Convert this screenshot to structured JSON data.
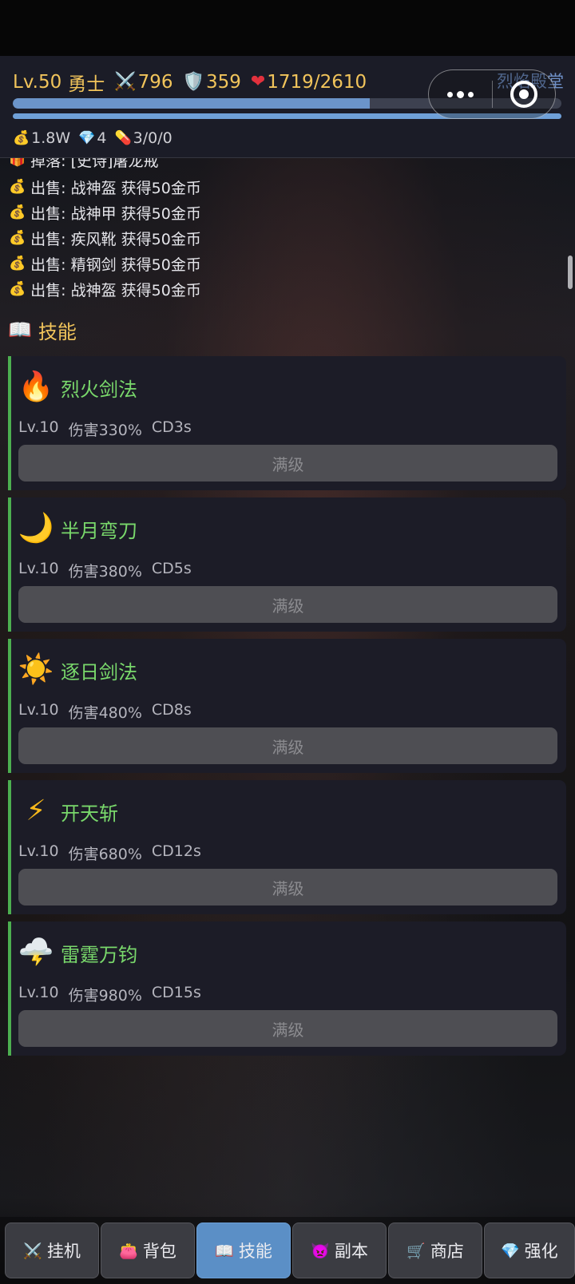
{
  "header": {
    "level": "Lv.50",
    "class_name": "勇士",
    "attack": "796",
    "defense": "359",
    "hp": "1719/2610",
    "title_right": "烈焰殿堂",
    "exp_fraction": 0.65,
    "hp_fraction": 1.0,
    "gold": "1.8W",
    "diamonds": "4",
    "potions": "3/0/0"
  },
  "icons": {
    "attack": "crossed-swords-icon",
    "defense": "shield-icon",
    "hp": "heart-icon",
    "gold": "money-bag-icon",
    "diamond": "gem-icon",
    "potion": "pill-icon"
  },
  "log": {
    "first": "掉落: [史诗]屠龙戒",
    "lines": [
      "出售: 战神盔  获得50金币",
      "出售: 战神甲  获得50金币",
      "出售: 疾风靴  获得50金币",
      "出售: 精钢剑  获得50金币",
      "出售: 战神盔  获得50金币"
    ]
  },
  "section": {
    "title": "技能"
  },
  "skills": [
    {
      "name": "烈火剑法",
      "level": "Lv.10",
      "damage": "伤害330%",
      "cd": "CD3s",
      "button": "满级",
      "icon": "fire-icon"
    },
    {
      "name": "半月弯刀",
      "level": "Lv.10",
      "damage": "伤害380%",
      "cd": "CD5s",
      "button": "满级",
      "icon": "crescent-moon-icon"
    },
    {
      "name": "逐日剑法",
      "level": "Lv.10",
      "damage": "伤害480%",
      "cd": "CD8s",
      "button": "满级",
      "icon": "sun-icon"
    },
    {
      "name": "开天斩",
      "level": "Lv.10",
      "damage": "伤害680%",
      "cd": "CD12s",
      "button": "满级",
      "icon": "lightning-icon"
    },
    {
      "name": "雷霆万钧",
      "level": "Lv.10",
      "damage": "伤害980%",
      "cd": "CD15s",
      "button": "满级",
      "icon": "storm-cloud-icon"
    }
  ],
  "nav": [
    {
      "label": "挂机",
      "icon": "crossed-swords-icon",
      "active": false
    },
    {
      "label": "背包",
      "icon": "backpack-icon",
      "active": false
    },
    {
      "label": "技能",
      "icon": "book-icon",
      "active": true
    },
    {
      "label": "副本",
      "icon": "demon-icon",
      "active": false
    },
    {
      "label": "商店",
      "icon": "cart-icon",
      "active": false
    },
    {
      "label": "强化",
      "icon": "gem-icon",
      "active": false
    }
  ],
  "colors": {
    "accent_gold": "#f1c45b",
    "skill_name_green": "#79d86b",
    "active_tab": "#5b8fc6",
    "card_bg": "#1c1c27"
  }
}
